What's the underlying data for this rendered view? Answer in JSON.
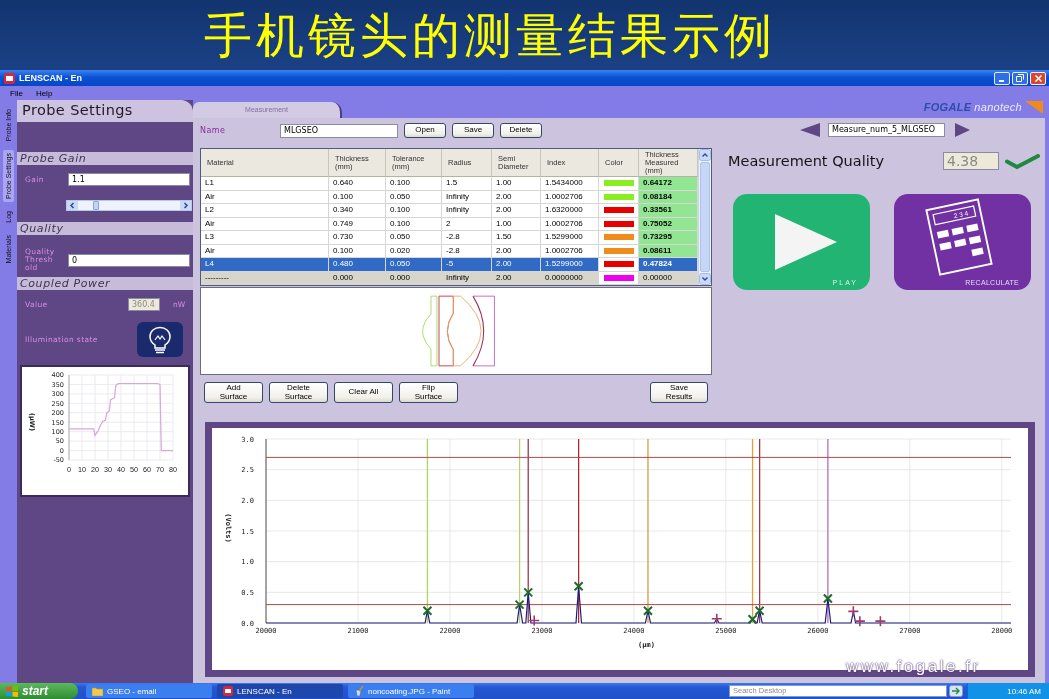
{
  "slide": {
    "title": "手机镜头的测量结果示例",
    "footer_url": "www.fogale.fr"
  },
  "window": {
    "title": "LENSCAN - En"
  },
  "menu": [
    "File",
    "Help"
  ],
  "side_tabs": [
    {
      "label": "Probe Info",
      "selected": false
    },
    {
      "label": "Probe Settings",
      "selected": true
    },
    {
      "label": "Log",
      "selected": false
    },
    {
      "label": "Materials",
      "selected": false
    }
  ],
  "probe_panel": {
    "title": "Probe Settings",
    "probe_gain": {
      "title": "Probe Gain",
      "label": "Gain",
      "value": "1.1",
      "disabled": false,
      "slider": {
        "level": 0.16
      }
    },
    "quality": {
      "title": "Quality",
      "label": "Quality\nThresh\nold",
      "value": "0",
      "disabled": false
    },
    "coupled_power": {
      "title": "Coupled Power",
      "label": "Value",
      "value": "360.4",
      "disabled": true,
      "unit": "nW",
      "illumination_label": "Illumination state",
      "chart_data": {
        "type": "line",
        "ylabel": "(µW)",
        "grid": true,
        "xlim": [
          0,
          80
        ],
        "ylim": [
          -50,
          400
        ],
        "xticks": [
          0,
          10,
          20,
          30,
          40,
          50,
          60,
          70,
          80
        ],
        "yticks": [
          -50,
          0,
          50,
          100,
          150,
          200,
          250,
          300,
          350,
          400
        ],
        "x": [
          0,
          19,
          20,
          22,
          24,
          26,
          28,
          29,
          31,
          32,
          35,
          36,
          38,
          68,
          70,
          70.5,
          71,
          80
        ],
        "series": [
          {
            "color": "#d6a6dc",
            "values": [
              115,
              115,
              80,
              100,
              130,
              155,
              160,
              200,
              210,
              270,
              280,
              345,
              355,
              355,
              350,
              180,
              0,
              0
            ]
          }
        ]
      }
    }
  },
  "logo": {
    "brand": "FOGALE",
    "suffix": "nanotech"
  },
  "measurement": {
    "tab": {
      "label": "Measurement",
      "selected": true
    },
    "name_label": "Name",
    "name_value": "MLGSEO",
    "file_buttons": [
      "Open",
      "Save",
      "Delete"
    ],
    "table": {
      "columns": [
        "Material",
        "Thickness\n(mm)",
        "Tolerance\n(mm)",
        "Radius",
        "Semi\nDiameter",
        "Index",
        "Color",
        "Thickness\nMeasured\n(mm)"
      ],
      "rows": [
        {
          "kind": "layer",
          "selected": false,
          "cells": [
            "L1",
            "0.640",
            "0.100",
            "1.5",
            "1.00",
            "1.5434000"
          ],
          "color": "#88ee22",
          "measured": "0.64172"
        },
        {
          "kind": "layer",
          "selected": false,
          "cells": [
            "Air",
            "0.100",
            "0.050",
            "Infinity",
            "2.00",
            "1.0002706"
          ],
          "color": "#88ee22",
          "measured": "0.08184"
        },
        {
          "kind": "layer",
          "selected": false,
          "cells": [
            "L2",
            "0.340",
            "0.100",
            "Infinity",
            "2.00",
            "1.6320000"
          ],
          "color": "#e80000",
          "measured": "0.33561"
        },
        {
          "kind": "layer",
          "selected": false,
          "cells": [
            "Air",
            "0.749",
            "0.100",
            "2",
            "1.00",
            "1.0002706"
          ],
          "color": "#e80000",
          "measured": "0.75052"
        },
        {
          "kind": "layer",
          "selected": false,
          "cells": [
            "L3",
            "0.730",
            "0.050",
            "-2.8",
            "1.50",
            "1.5299000"
          ],
          "color": "#f08c1c",
          "measured": "0.73295"
        },
        {
          "kind": "layer",
          "selected": false,
          "cells": [
            "Air",
            "0.100",
            "0.020",
            "-2.8",
            "2.00",
            "1.0002706"
          ],
          "color": "#f08c1c",
          "measured": "0.08611"
        },
        {
          "kind": "layer",
          "selected": true,
          "cells": [
            "L4",
            "0.480",
            "0.050",
            "-5",
            "2.00",
            "1.5299000"
          ],
          "color": "#e80000",
          "measured": "0.47824"
        },
        {
          "kind": "placeholder",
          "selected": false,
          "cells": [
            "---------",
            "0.000",
            "0.000",
            "Infinity",
            "2.00",
            "0.0000000"
          ],
          "color": "#ee00ee",
          "measured": "0.00000"
        }
      ]
    },
    "surface_buttons": [
      "Add Surface",
      "Delete\nSurface",
      "Clear All",
      "Flip Surface"
    ],
    "save_button": "Save\nResults"
  },
  "navigator": {
    "value": "Measure_num_5_MLGSEO"
  },
  "quality_display": {
    "label": "Measurement Quality",
    "value": "4.38",
    "disabled": true,
    "passed": true
  },
  "tiles": [
    {
      "kind": "play",
      "label": "PLAY"
    },
    {
      "kind": "recalculate",
      "label": "RECALCULATE",
      "display": "2 3 4"
    }
  ],
  "spectrum": {
    "chart_data": {
      "type": "line",
      "xlabel": "(µm)",
      "ylabel": "(Volts)",
      "grid": true,
      "xlim": [
        20000,
        28100
      ],
      "ylim": [
        0,
        3
      ],
      "xticks": [
        20000,
        21000,
        22000,
        23000,
        24000,
        25000,
        26000,
        27000,
        28000
      ],
      "yticks": [
        {
          "value": 0,
          "label": "0.0"
        },
        {
          "value": 0.5,
          "label": "0.5"
        },
        {
          "value": 1,
          "label": "1.0"
        },
        {
          "value": 1.5,
          "label": "1.5"
        },
        {
          "value": 2,
          "label": "2.0"
        },
        {
          "value": 2.5,
          "label": "2.5"
        },
        {
          "value": 3,
          "label": "3.0"
        }
      ],
      "x": [
        20000,
        21730,
        21755,
        21780,
        22730,
        22757,
        22790,
        22825,
        22851,
        22880,
        22916,
        23370,
        23399,
        23430,
        24125,
        24153,
        24180,
        24875,
        24901,
        24925,
        25265,
        25290,
        25315,
        25340,
        25367,
        25395,
        26080,
        26109,
        26140,
        26360,
        26386,
        26410,
        26457,
        26680,
        28100
      ],
      "series": [
        {
          "color": "#1c1c7c",
          "values": [
            0,
            0,
            0.2,
            0,
            0,
            0.3,
            0,
            0,
            0.5,
            0,
            0,
            0,
            0.6,
            0,
            0,
            0.2,
            0,
            0,
            0.07,
            0,
            0,
            0.06,
            0,
            0,
            0.2,
            0,
            0,
            0.4,
            0,
            0,
            0.19,
            0,
            0,
            0,
            0
          ]
        },
        {
          "type": "scatter",
          "color": "#1d6b2e",
          "marker": "x",
          "values": [
            null,
            null,
            0.2,
            null,
            null,
            0.3,
            null,
            null,
            0.5,
            null,
            null,
            null,
            0.6,
            null,
            null,
            0.2,
            null,
            null,
            null,
            null,
            null,
            0.06,
            null,
            null,
            0.2,
            null,
            null,
            0.4,
            null,
            null,
            null,
            null,
            null,
            null,
            null
          ]
        },
        {
          "type": "scatter",
          "color": "#a03a6a",
          "marker": "+",
          "values": [
            null,
            null,
            null,
            null,
            null,
            null,
            null,
            null,
            null,
            null,
            0.04,
            null,
            null,
            null,
            null,
            null,
            null,
            null,
            0.07,
            null,
            null,
            null,
            null,
            null,
            null,
            null,
            null,
            null,
            null,
            null,
            0.19,
            null,
            0.03,
            0.03,
            null
          ]
        }
      ],
      "ref_lines": [
        {
          "axis": "x",
          "value": 21755,
          "color": "#a8d860"
        },
        {
          "axis": "x",
          "value": 22757,
          "color": "#b8d070"
        },
        {
          "axis": "x",
          "value": 22851,
          "color": "#a03848"
        },
        {
          "axis": "x",
          "value": 23399,
          "color": "#b02828"
        },
        {
          "axis": "x",
          "value": 24153,
          "color": "#d0a040"
        },
        {
          "axis": "x",
          "value": 25290,
          "color": "#e0a040"
        },
        {
          "axis": "x",
          "value": 25367,
          "color": "#a03848"
        },
        {
          "axis": "x",
          "value": 26109,
          "color": "#b070c0"
        },
        {
          "axis": "y",
          "value": 2.7,
          "color": "#b04848"
        },
        {
          "axis": "y",
          "value": 0.3,
          "color": "#b04848"
        }
      ]
    }
  },
  "taskbar": {
    "start": "start",
    "items": [
      {
        "kind": "folder",
        "label": "GSEO - email",
        "selected": false
      },
      {
        "kind": "app",
        "label": "LENSCAN - En",
        "selected": true
      },
      {
        "kind": "paint",
        "label": "noncoating.JPG - Paint",
        "selected": false
      }
    ],
    "search": {
      "placeholder": "Search Desktop"
    },
    "clock": "10:46 AM"
  }
}
